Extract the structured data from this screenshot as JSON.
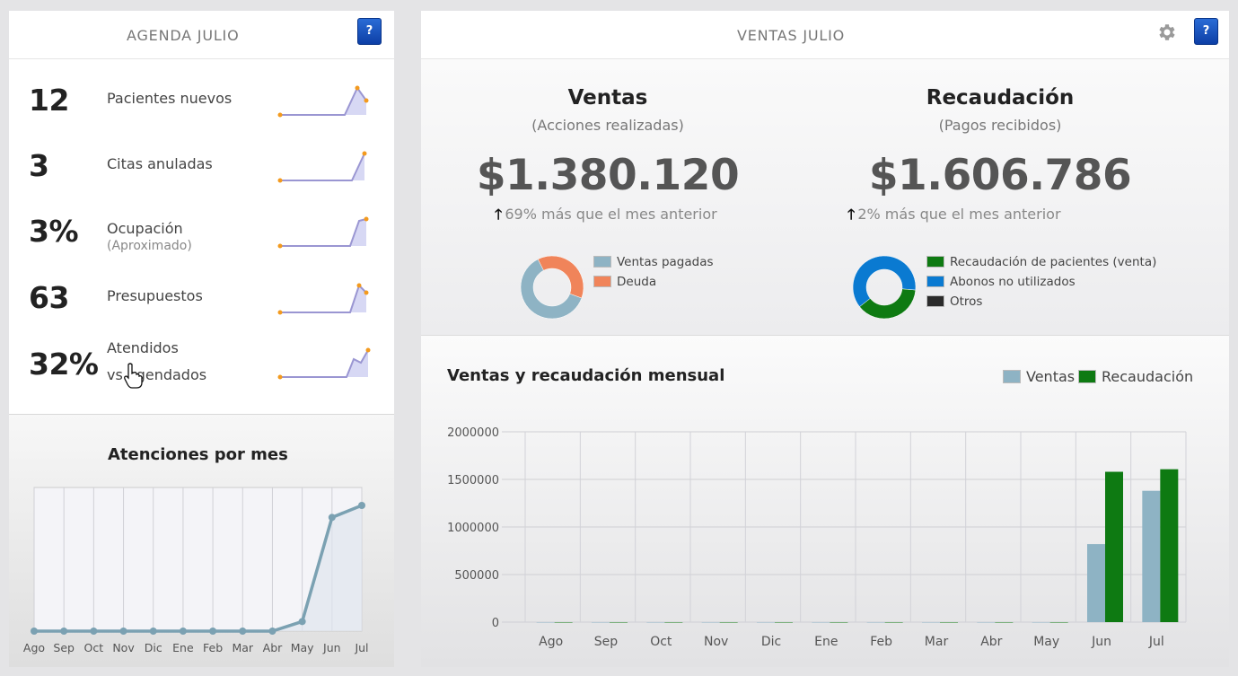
{
  "agenda": {
    "title": "AGENDA JULIO",
    "help_label": "?",
    "stats": [
      {
        "value": "12",
        "label": "Pacientes nuevos",
        "sublabel": ""
      },
      {
        "value": "3",
        "label": "Citas anuladas",
        "sublabel": ""
      },
      {
        "value": "3%",
        "label": "Ocupación",
        "sublabel": "(Aproximado)"
      },
      {
        "value": "63",
        "label": "Presupuestos",
        "sublabel": ""
      },
      {
        "value": "32%",
        "label": "Atendidos",
        "sublabel": "vs agendados"
      }
    ],
    "atenciones": {
      "title": "Atenciones por mes"
    }
  },
  "ventas": {
    "title": "VENTAS JULIO",
    "help_label": "?",
    "gear_icon": "gear-icon",
    "ventas_kpi": {
      "title": "Ventas",
      "subtitle": "(Acciones realizadas)",
      "value": "$1.380.120",
      "delta": "69% más que el mes anterior",
      "legend": [
        "Ventas pagadas",
        "Deuda"
      ]
    },
    "recaudacion_kpi": {
      "title": "Recaudación",
      "subtitle": "(Pagos recibidos)",
      "value": "$1.606.786",
      "delta": "2% más que el mes anterior",
      "legend": [
        "Recaudación de pacientes (venta)",
        "Abonos no utilizados",
        "Otros"
      ]
    },
    "monthly": {
      "title": "Ventas y recaudación mensual"
    }
  },
  "colors": {
    "ventas": "#8eb3c4",
    "recaudacion": "#0e7a12",
    "deuda": "#f0845a",
    "abonos": "#0a7ad1",
    "otros": "#2b2b2b",
    "sparkline": "#9a96d2",
    "spark_dot": "#f39a1e",
    "help_button": "#1a52c0"
  },
  "chart_data": [
    {
      "type": "line",
      "title": "Atenciones por mes",
      "categories": [
        "Ago",
        "Sep",
        "Oct",
        "Nov",
        "Dic",
        "Ene",
        "Feb",
        "Mar",
        "Abr",
        "May",
        "Jun",
        "Jul"
      ],
      "series": [
        {
          "values": [
            0,
            0,
            0,
            0,
            0,
            0,
            0,
            0,
            0,
            8,
            95,
            105
          ]
        }
      ],
      "ylim": [
        0,
        120
      ],
      "grid": true
    },
    {
      "type": "bar",
      "title": "Ventas y recaudación mensual",
      "categories": [
        "Ago",
        "Sep",
        "Oct",
        "Nov",
        "Dic",
        "Ene",
        "Feb",
        "Mar",
        "Abr",
        "May",
        "Jun",
        "Jul"
      ],
      "series": [
        {
          "name": "Ventas",
          "values": [
            0,
            0,
            0,
            0,
            0,
            0,
            0,
            0,
            0,
            0,
            820000,
            1380120
          ]
        },
        {
          "name": "Recaudación",
          "values": [
            0,
            0,
            0,
            0,
            0,
            0,
            0,
            0,
            0,
            0,
            1580000,
            1606786
          ]
        }
      ],
      "yticks": [
        "2000000",
        "1500000",
        "1000000",
        "500000",
        "0"
      ],
      "ylim": [
        0,
        2000000
      ],
      "legend": "top-right",
      "grid": true
    },
    {
      "type": "pie",
      "title": "Ventas",
      "slices": [
        {
          "name": "Ventas pagadas",
          "value": 62
        },
        {
          "name": "Deuda",
          "value": 38
        }
      ]
    },
    {
      "type": "pie",
      "title": "Recaudación",
      "slices": [
        {
          "name": "Recaudación de pacientes (venta)",
          "value": 38
        },
        {
          "name": "Abonos no utilizados",
          "value": 62
        },
        {
          "name": "Otros",
          "value": 0
        }
      ]
    }
  ]
}
